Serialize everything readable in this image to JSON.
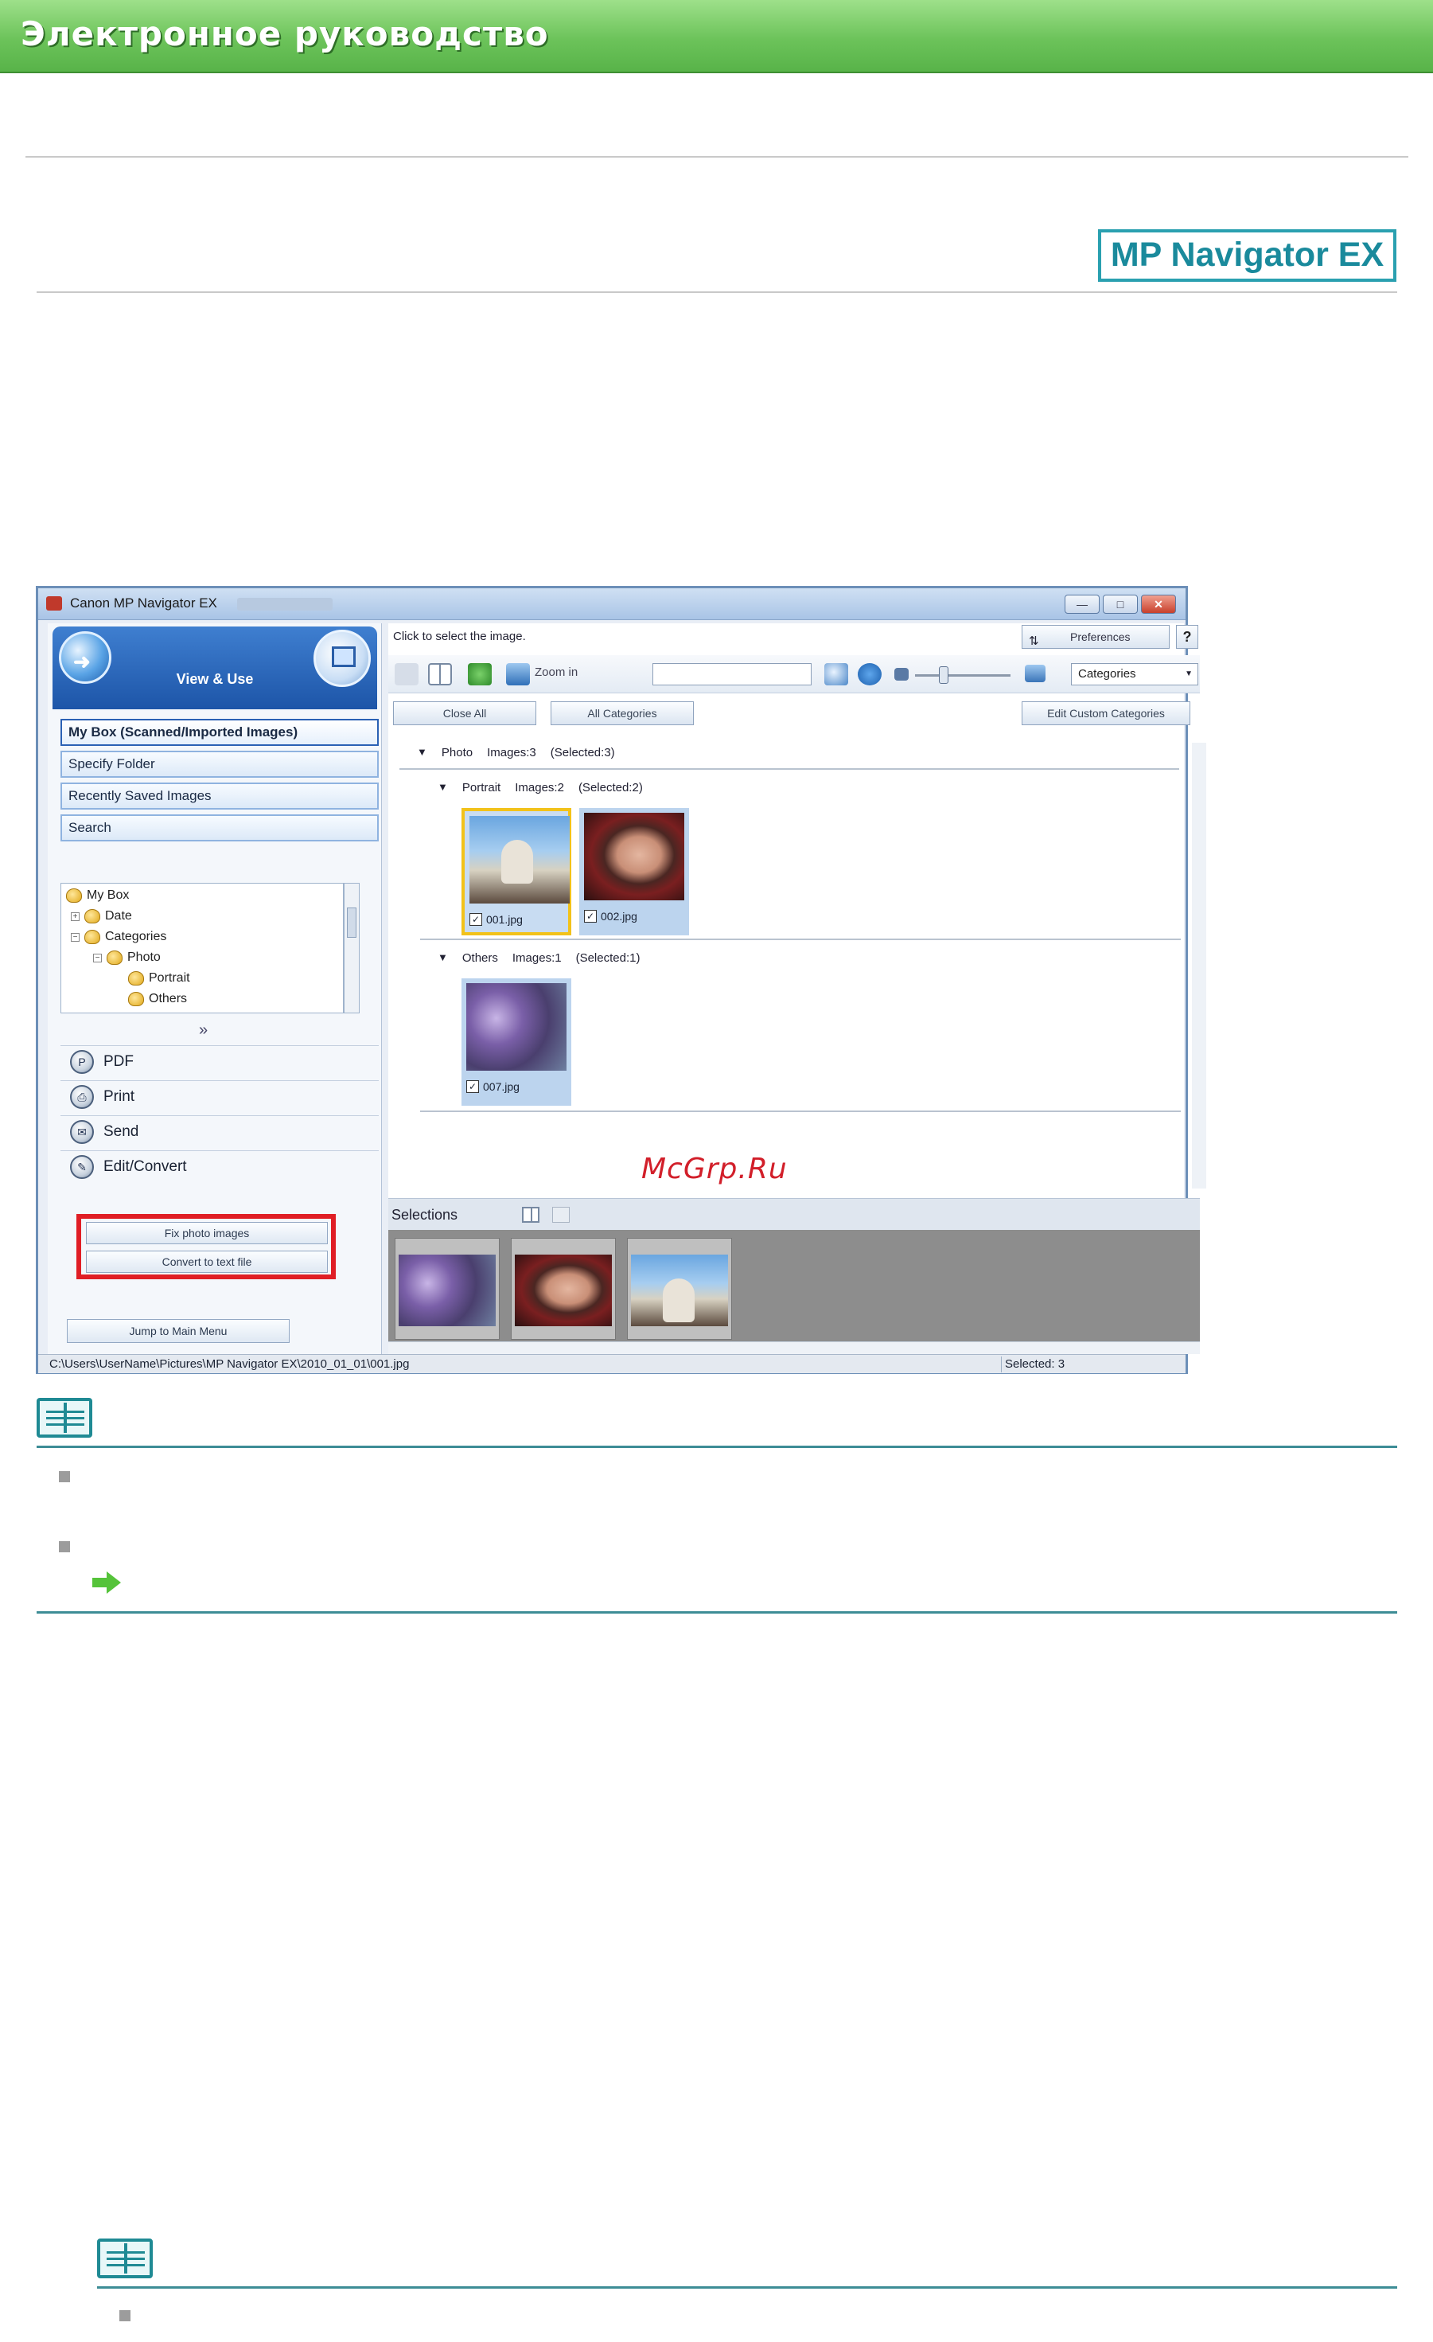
{
  "page": {
    "banner_title": "Электронное руководство",
    "logo_text": "MP Navigator EX",
    "watermark": "McGrp.Ru"
  },
  "window": {
    "title": "Canon MP Navigator EX",
    "left_pane": {
      "mode_title": "View & Use",
      "nav": [
        {
          "label": "My Box (Scanned/Imported Images)",
          "active": true
        },
        {
          "label": "Specify Folder"
        },
        {
          "label": "Recently Saved Images"
        },
        {
          "label": "Search"
        }
      ],
      "tree": [
        "My Box",
        "Date",
        "Categories",
        "Photo",
        "Portrait",
        "Others"
      ],
      "actions": [
        {
          "label": "PDF",
          "icon": "pdf-icon"
        },
        {
          "label": "Print",
          "icon": "print-icon"
        },
        {
          "label": "Send",
          "icon": "send-icon"
        },
        {
          "label": "Edit/Convert",
          "icon": "edit-convert-icon"
        }
      ],
      "sub_actions": [
        "Fix photo images",
        "Convert to text file"
      ],
      "jump_button": "Jump to Main Menu"
    },
    "right_pane": {
      "hint": "Click to select the image.",
      "preferences_label": "Preferences",
      "help_label": "?",
      "zoom_label": "Zoom in",
      "search_value": "",
      "view_select": "Categories",
      "buttons": {
        "close_all": "Close All",
        "all_categories": "All Categories",
        "edit_custom": "Edit Custom Categories"
      },
      "groups": {
        "photo": {
          "name": "Photo",
          "images": "Images:3",
          "selected": "(Selected:3)"
        },
        "portrait": {
          "name": "Portrait",
          "images": "Images:2",
          "selected": "(Selected:2)"
        },
        "others": {
          "name": "Others",
          "images": "Images:1",
          "selected": "(Selected:1)"
        }
      },
      "thumbs": [
        {
          "file": "001.jpg",
          "checked": "✓"
        },
        {
          "file": "002.jpg",
          "checked": "✓"
        },
        {
          "file": "007.jpg",
          "checked": "✓"
        }
      ],
      "selections_label": "Selections"
    },
    "status": {
      "path": "C:\\Users\\UserName\\Pictures\\MP Navigator EX\\2010_01_01\\001.jpg",
      "selected": "Selected: 3"
    }
  }
}
